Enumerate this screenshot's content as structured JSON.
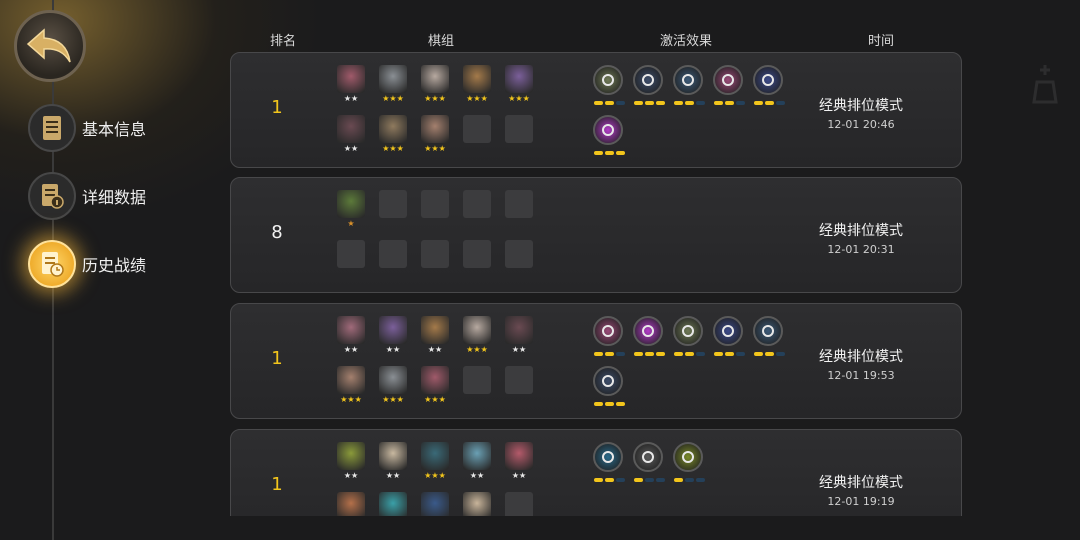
{
  "nav": {
    "back_label": "back",
    "items": [
      {
        "label": "基本信息",
        "icon": "document-icon"
      },
      {
        "label": "详细数据",
        "icon": "data-info-icon"
      },
      {
        "label": "历史战绩",
        "icon": "history-clock-icon"
      }
    ]
  },
  "headers": {
    "rank": "排名",
    "pieces": "棋组",
    "effects": "激活效果",
    "time": "时间"
  },
  "matches": [
    {
      "rank": "1",
      "mode": "经典排位模式",
      "time": "12-01 20:46",
      "pieces": [
        {
          "color": "#a05a6a",
          "stars": "★★"
        },
        {
          "color": "#8a8f94",
          "stars": "★★★"
        },
        {
          "color": "#b7a9a0",
          "stars": "★★★"
        },
        {
          "color": "#a47a4a",
          "stars": "★★★"
        },
        {
          "color": "#7b5f9a",
          "stars": "★★★"
        },
        {
          "color": "#6a4a52",
          "stars": "★★"
        },
        {
          "color": "#8f7a5e",
          "stars": "★★★"
        },
        {
          "color": "#a4806e",
          "stars": "★★★"
        },
        {
          "color": "",
          "stars": ""
        },
        {
          "color": "",
          "stars": ""
        }
      ],
      "traits": [
        {
          "color": "#6f7a56",
          "bar": [
            1,
            1,
            0
          ]
        },
        {
          "color": "#3d4d6a",
          "bar": [
            1,
            1,
            1
          ]
        },
        {
          "color": "#3c5a78",
          "bar": [
            1,
            1,
            0
          ]
        },
        {
          "color": "#9a4a78",
          "bar": [
            1,
            1,
            0
          ]
        },
        {
          "color": "#3c4a8a",
          "bar": [
            1,
            1,
            0
          ]
        },
        {
          "color": "#b33cc8",
          "bar": [
            1,
            1,
            1
          ]
        }
      ]
    },
    {
      "rank": "8",
      "mode": "经典排位模式",
      "time": "12-01 20:31",
      "pieces": [
        {
          "color": "#5c7a3a",
          "stars": "★"
        },
        {
          "color": "",
          "stars": ""
        },
        {
          "color": "",
          "stars": ""
        },
        {
          "color": "",
          "stars": ""
        },
        {
          "color": "",
          "stars": ""
        },
        {
          "color": "",
          "stars": ""
        },
        {
          "color": "",
          "stars": ""
        },
        {
          "color": "",
          "stars": ""
        },
        {
          "color": "",
          "stars": ""
        },
        {
          "color": "",
          "stars": ""
        }
      ],
      "traits": []
    },
    {
      "rank": "1",
      "mode": "经典排位模式",
      "time": "12-01 19:53",
      "pieces": [
        {
          "color": "#a06a7a",
          "stars": "★★"
        },
        {
          "color": "#7b5f9a",
          "stars": "★★"
        },
        {
          "color": "#a47a4a",
          "stars": "★★"
        },
        {
          "color": "#b7a9a0",
          "stars": "★★★"
        },
        {
          "color": "#6a4a52",
          "stars": "★★"
        },
        {
          "color": "#a4806e",
          "stars": "★★★"
        },
        {
          "color": "#8a8f94",
          "stars": "★★★"
        },
        {
          "color": "#a05a6a",
          "stars": "★★★"
        },
        {
          "color": "",
          "stars": ""
        },
        {
          "color": "",
          "stars": ""
        }
      ],
      "traits": [
        {
          "color": "#9a4a78",
          "bar": [
            1,
            1,
            0
          ]
        },
        {
          "color": "#b33cc8",
          "bar": [
            1,
            1,
            1
          ]
        },
        {
          "color": "#6f7a56",
          "bar": [
            1,
            1,
            0
          ]
        },
        {
          "color": "#3c4a8a",
          "bar": [
            1,
            1,
            0
          ]
        },
        {
          "color": "#3c5a78",
          "bar": [
            1,
            1,
            0
          ]
        },
        {
          "color": "#3d4d6a",
          "bar": [
            1,
            1,
            1
          ]
        }
      ]
    },
    {
      "rank": "1",
      "mode": "经典排位模式",
      "time": "12-01 19:19",
      "pieces": [
        {
          "color": "#8a9a3a",
          "stars": "★★"
        },
        {
          "color": "#c8b8a0",
          "stars": "★★"
        },
        {
          "color": "#3a6a78",
          "stars": "★★★"
        },
        {
          "color": "#6aa0b4",
          "stars": "★★"
        },
        {
          "color": "#b45a6a",
          "stars": "★★"
        },
        {
          "color": "#b4704a",
          "stars": ""
        },
        {
          "color": "#3aa0a8",
          "stars": ""
        },
        {
          "color": "#3a5a8a",
          "stars": ""
        },
        {
          "color": "#c8b49a",
          "stars": ""
        },
        {
          "color": "",
          "stars": ""
        }
      ],
      "traits": [
        {
          "color": "#2a6a8a",
          "bar": [
            1,
            1,
            0
          ]
        },
        {
          "color": "#5a5a5a",
          "bar": [
            1,
            0,
            0
          ]
        },
        {
          "color": "#7a8a2a",
          "bar": [
            1,
            0,
            0
          ]
        }
      ]
    }
  ]
}
